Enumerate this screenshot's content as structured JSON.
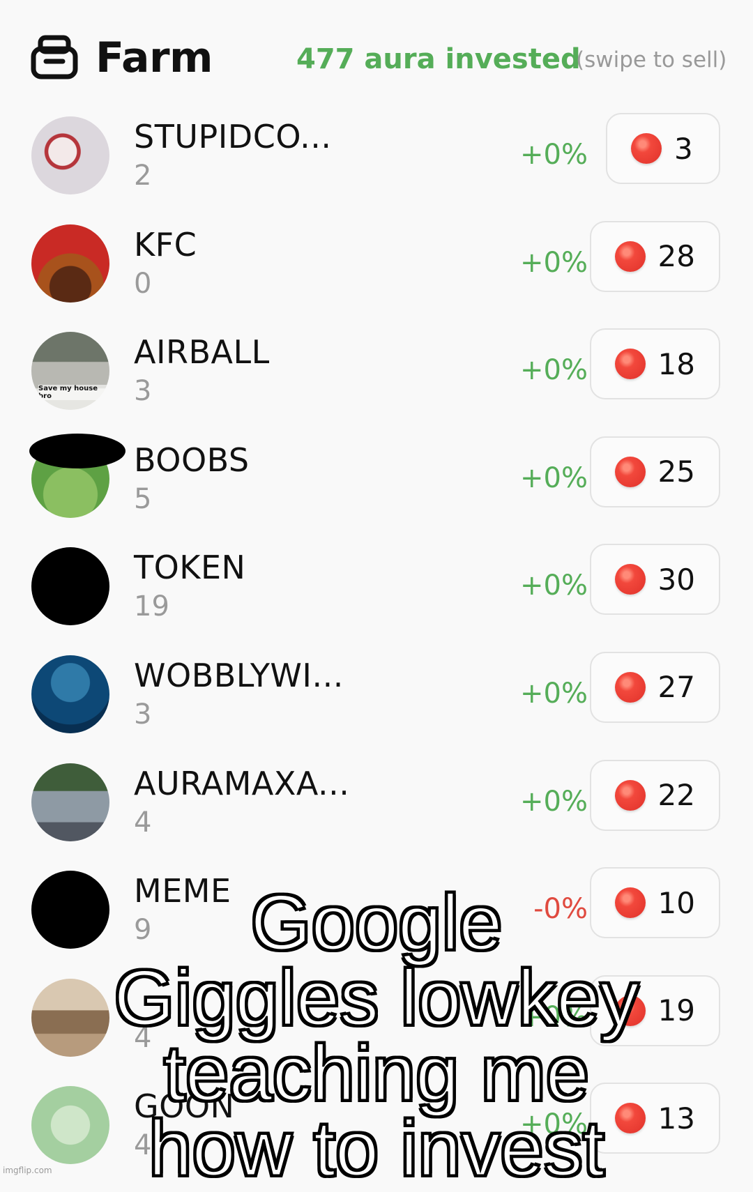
{
  "header": {
    "title": "Farm",
    "invested": "477 aura invested",
    "hint": "(swipe to sell)"
  },
  "colors": {
    "positive": "#55ad58",
    "negative": "#e04a3f",
    "coin": "#f2483c"
  },
  "rows": [
    {
      "name": "STUPIDCO...",
      "count": "2",
      "change": "+0%",
      "value": "3"
    },
    {
      "name": "KFC",
      "count": "0",
      "change": "+0%",
      "value": "28"
    },
    {
      "name": "AIRBALL",
      "count": "3",
      "change": "+0%",
      "value": "18",
      "avatar_text": "Save my house bro"
    },
    {
      "name": "BOOBS",
      "count": "5",
      "change": "+0%",
      "value": "25"
    },
    {
      "name": "TOKEN",
      "count": "19",
      "change": "+0%",
      "value": "30"
    },
    {
      "name": "WOBBLYWI...",
      "count": "3",
      "change": "+0%",
      "value": "27"
    },
    {
      "name": "AURAMAXA...",
      "count": "4",
      "change": "+0%",
      "value": "22"
    },
    {
      "name": "MEME",
      "count": "9",
      "change": "-0%",
      "value": "10"
    },
    {
      "name": "",
      "count": "4",
      "change": "+0%",
      "value": "19"
    },
    {
      "name": "GOON",
      "count": "4",
      "change": "+0%",
      "value": "13"
    }
  ],
  "caption": [
    "Google",
    "Giggles lowkey",
    "teaching me",
    "how to invest"
  ],
  "watermark": "imgflip.com"
}
